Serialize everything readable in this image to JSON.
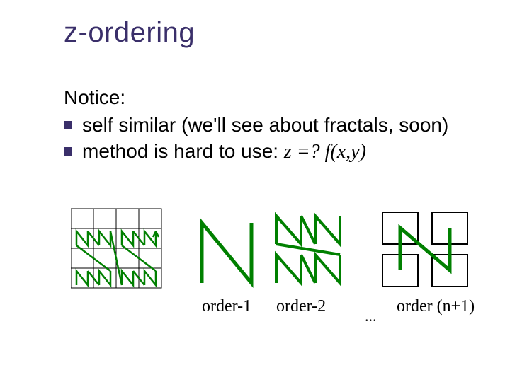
{
  "title": "z-ordering",
  "notice": "Notice:",
  "bullets": [
    "self similar (we'll see about fractals, soon)",
    "method is hard to use: "
  ],
  "formula": "z =? f(x,y)",
  "captions": {
    "order1": "order-1",
    "order2": "order-2",
    "dots": "...",
    "ordern": "order (n+1)"
  },
  "colors": {
    "accent": "#3a2f6a",
    "stroke_dark": "#008000",
    "grid": "#000000"
  }
}
